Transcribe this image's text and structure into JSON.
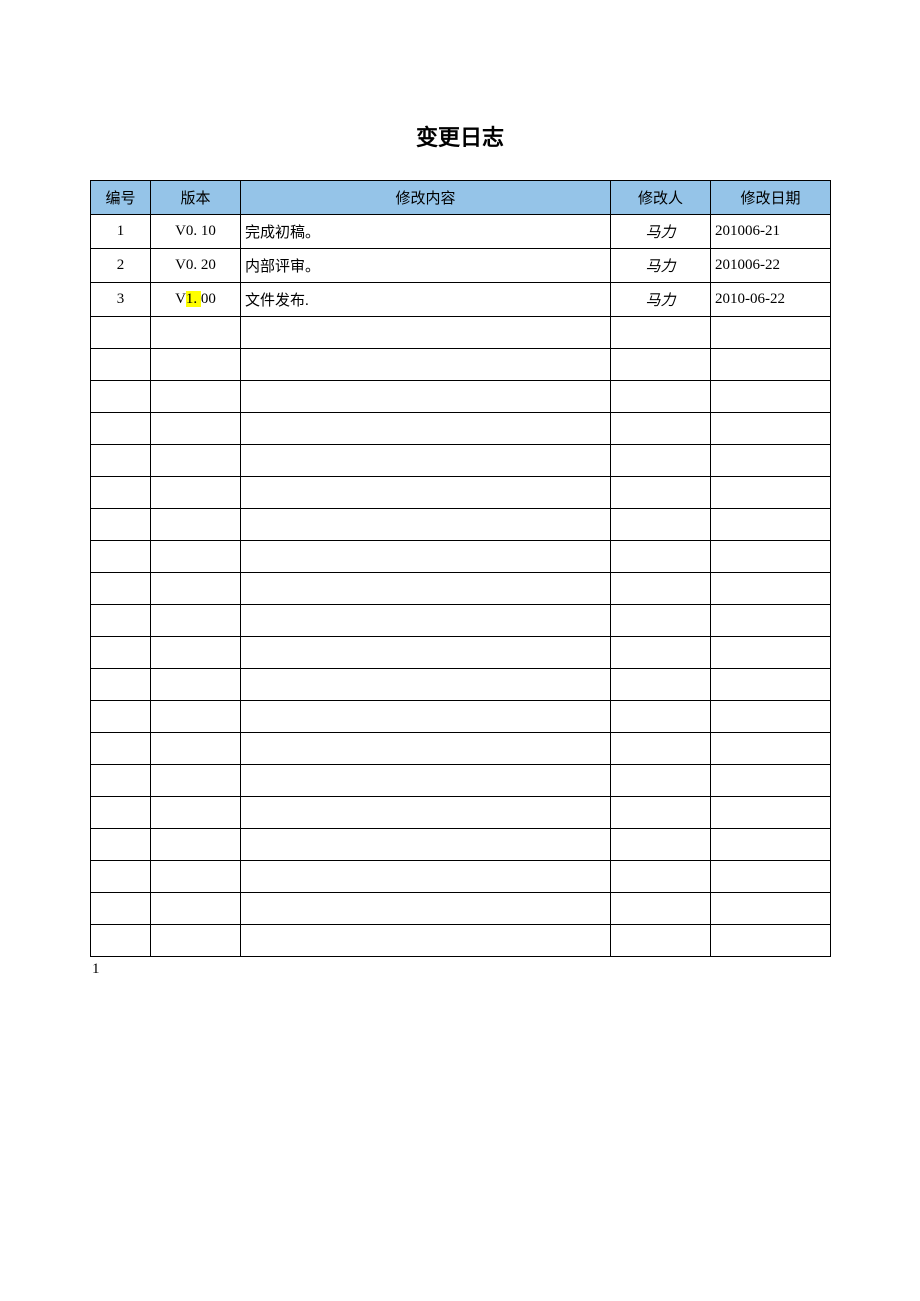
{
  "title": "变更日志",
  "headers": {
    "id": "编号",
    "version": "版本",
    "content": "修改内容",
    "modifier": "修改人",
    "date": "修改日期"
  },
  "rows": [
    {
      "id": "1",
      "version_pre": "V0. ",
      "version_hl": "",
      "version_post": "10",
      "content": "完成初稿。",
      "modifier": "马力",
      "date": "201006-21"
    },
    {
      "id": "2",
      "version_pre": "V0. ",
      "version_hl": "",
      "version_post": "20",
      "content": "内部评审。",
      "modifier": "马力",
      "date": "201006-22"
    },
    {
      "id": "3",
      "version_pre": "V",
      "version_hl": "1. ",
      "version_post": "00",
      "content": "文件发布.",
      "modifier": "马力",
      "date": "2010-06-22"
    }
  ],
  "empty_row_count": 20,
  "footer_number": "1",
  "col_widths": {
    "id": "60",
    "version": "90",
    "content": "370",
    "modifier": "100",
    "date": "120"
  }
}
